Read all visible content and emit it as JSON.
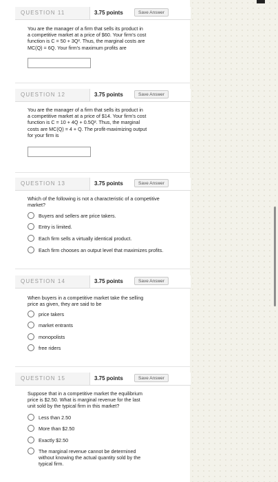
{
  "questions": [
    {
      "label": "QUESTION 11",
      "points": "3.75 points",
      "save": "Save Answer",
      "text": "You are the manager of a firm that sells its product in\na competitive market at a price of $60. Your firm's cost\nfunction is C = 50 + 3Q². Thus, the marginal costs are\nMC(Q) = 6Q. Your firm's maximum profits are"
    },
    {
      "label": "QUESTION 12",
      "points": "3.75 points",
      "save": "Save Answer",
      "text": "You are the manager of a firm that sells its product in\na competitive market at a price of $14. Your firm's cost\nfunction is C = 10 + 4Q + 0.5Q². Thus, the marginal\ncosts are MC(Q) = 4 + Q. The profit-maximizing output\nfor your firm is"
    },
    {
      "label": "QUESTION 13",
      "points": "3.75 points",
      "save": "Save Answer",
      "text": "Which of the following is not a characteristic of a competitive\nmarket?",
      "options": [
        "Buyers and sellers are price takers.",
        "Entry is limited.",
        "Each firm sells a virtually identical product.",
        "Each firm chooses an output level that maximizes profits."
      ]
    },
    {
      "label": "QUESTION 14",
      "points": "3.75 points",
      "save": "Save Answer",
      "text": "When buyers in a competitive market take the selling\nprice as given, they are said to be",
      "options": [
        "price takers",
        "market entrants",
        "monopolists",
        "free riders"
      ]
    },
    {
      "label": "QUESTION 15",
      "points": "3.75 points",
      "save": "Save Answer",
      "text": "Suppose that in a competitive market the equilibrium\nprice is $2.50. What is marginal revenue for the last\nunit sold by the typical firm in this market?",
      "options": [
        "Less than 2.50",
        "More than $2.50",
        "Exactly $2.50",
        "The marginal revenue cannot be determined\nwithout knowing the actual quantity sold by the\ntypical firm."
      ]
    }
  ]
}
